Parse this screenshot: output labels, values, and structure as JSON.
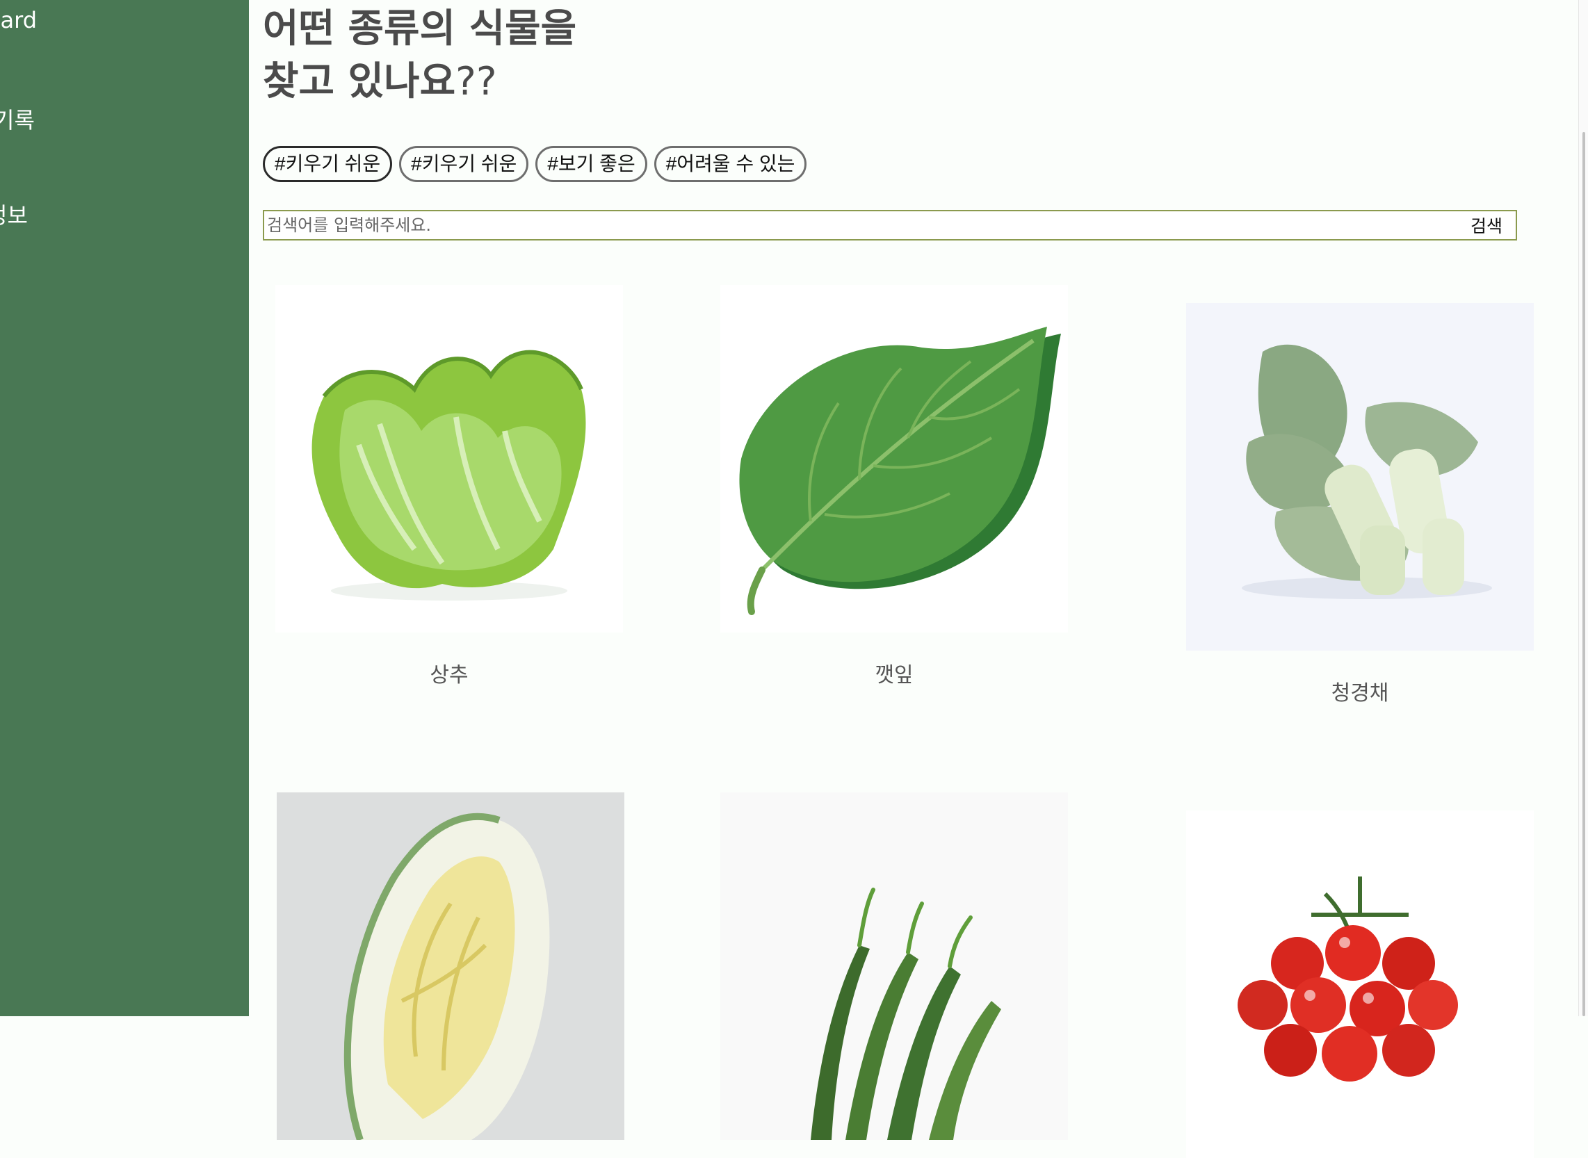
{
  "sidebar": {
    "items": [
      {
        "label": "Garden Dashboard"
      },
      {
        "label": "재배 기록"
      },
      {
        "label": "식물 정보"
      }
    ]
  },
  "headline": {
    "line1": "어떤 종류의 식물을",
    "line2": "찾고 있나요",
    "suffix": "??"
  },
  "tags": [
    "#키우기 쉬운",
    "#키우기 쉬운",
    "#보기 좋은",
    "#어려울 수 있는"
  ],
  "search": {
    "placeholder": "검색어를 입력해주세요.",
    "button_label": "검색"
  },
  "plants": [
    {
      "name": "상추",
      "icon": "lettuce-image"
    },
    {
      "name": "깻잎",
      "icon": "perilla-leaf-image"
    },
    {
      "name": "청경채",
      "icon": "bok-choy-image"
    },
    {
      "name": "",
      "icon": "napa-cabbage-image"
    },
    {
      "name": "",
      "icon": "green-chili-pepper-image"
    },
    {
      "name": "",
      "icon": "cherry-tomato-image"
    }
  ],
  "colors": {
    "sidebar_bg": "#497854",
    "page_bg": "#fbfefb",
    "search_border": "#8b9a4e"
  }
}
